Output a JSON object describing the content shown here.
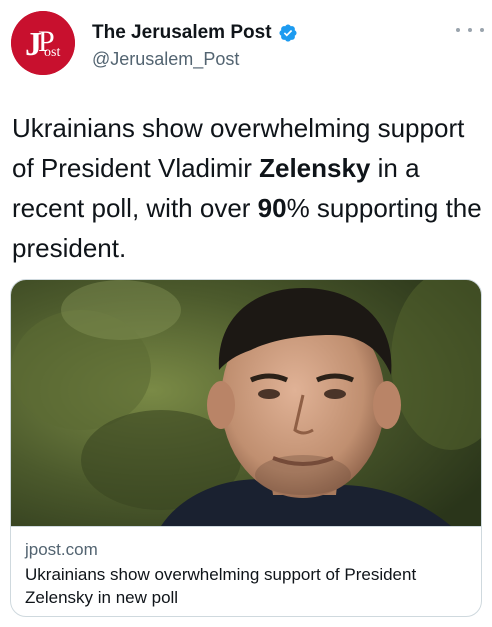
{
  "author": {
    "display_name": "The Jerusalem Post",
    "handle": "@Jerusalem_Post",
    "avatar_text": "JPost",
    "brand_color": "#c8102e",
    "verified": true
  },
  "tweet": {
    "segments": [
      {
        "text": "Ukrainians show overwhelming support of President Vladimir ",
        "bold": false
      },
      {
        "text": "Zelensky",
        "bold": true
      },
      {
        "text": " in a recent poll, with over ",
        "bold": false
      },
      {
        "text": "90",
        "bold": true
      },
      {
        "text": "% supporting the president.",
        "bold": false
      }
    ]
  },
  "card": {
    "domain": "jpost.com",
    "title": "Ukrainians show overwhelming support of President Zelensky in new poll",
    "image": "photo of man in dark jacket, outdoor green background"
  },
  "icons": {
    "verified": "verified-badge-icon",
    "more": "more-options-icon"
  },
  "colors": {
    "verified_blue": "#1d9bf0",
    "text_secondary": "#536471",
    "border": "#cfd9de"
  }
}
